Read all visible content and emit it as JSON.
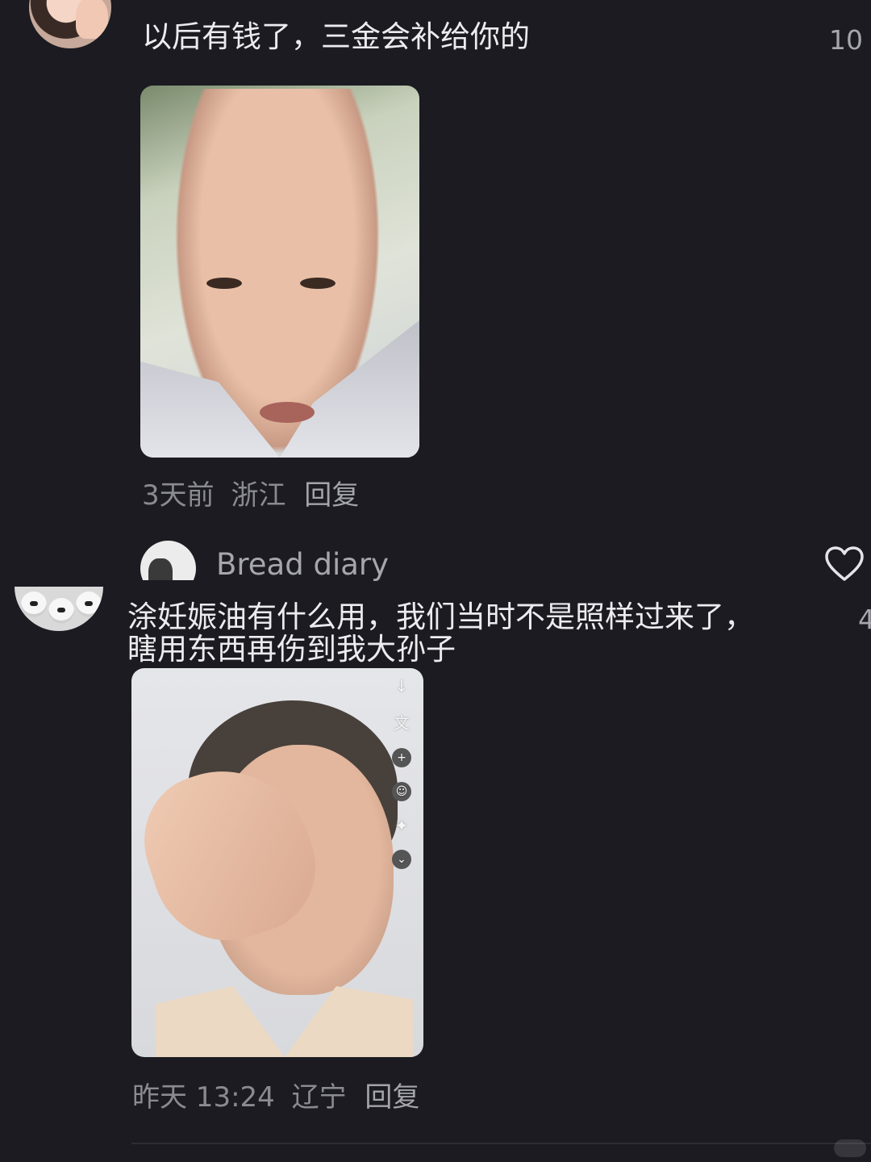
{
  "comment1": {
    "text": "以后有钱了，三金会补给你的",
    "likes": "10",
    "time": "3天前",
    "region": "浙江",
    "reply_label": "回复"
  },
  "comment2": {
    "username": "Bread diary",
    "like_icon": "heart-icon"
  },
  "comment3": {
    "text_line1": "涂妊娠油有什么用，我们当时不是照样过来了，",
    "text_line2": "瞎用东西再伤到我大孙子",
    "likes": "4",
    "time": "昨天 13:24",
    "region": "辽宁",
    "reply_label": "回复",
    "photo_tools": [
      "↓",
      "文"
    ]
  },
  "colors": {
    "background": "#1b1b21",
    "text": "#ececf0",
    "meta": "#8a8a91"
  }
}
